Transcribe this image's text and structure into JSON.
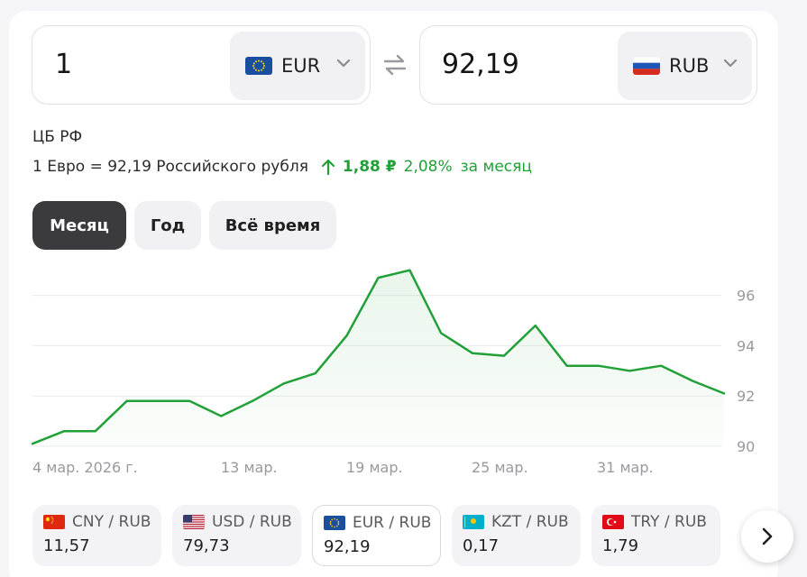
{
  "converter": {
    "from": {
      "amount": "1",
      "currency": "EUR",
      "flag_icon": "eu-flag-icon"
    },
    "to": {
      "amount": "92,19",
      "currency": "RUB",
      "flag_icon": "ru-flag-icon"
    },
    "swap_icon": "swap-icon"
  },
  "source": "ЦБ РФ",
  "rate": {
    "text": "1 Евро = 92,19 Российского рубля",
    "change_abs": "1,88 ₽",
    "change_pct": "2,08%",
    "period": "за месяц",
    "trend": "up",
    "accent_color": "#21a038"
  },
  "tabs": [
    {
      "label": "Месяц",
      "active": true
    },
    {
      "label": "Год",
      "active": false
    },
    {
      "label": "Всё время",
      "active": false
    }
  ],
  "chart_data": {
    "type": "area",
    "x_labels": [
      "4 мар. 2026 г.",
      "13 мар.",
      "19 мар.",
      "25 мар.",
      "31 мар."
    ],
    "y_ticks": [
      90,
      92,
      94,
      96
    ],
    "ylim": [
      90,
      97
    ],
    "values": [
      90.1,
      90.6,
      90.6,
      91.8,
      91.8,
      91.8,
      91.2,
      91.8,
      92.5,
      92.9,
      94.4,
      96.7,
      97.0,
      94.5,
      93.7,
      93.6,
      94.8,
      93.2,
      93.2,
      93.0,
      93.2,
      92.6,
      92.1
    ],
    "line_color": "#21a038",
    "grid": true
  },
  "pairs": [
    {
      "label": "CNY / RUB",
      "value": "11,57",
      "flag_icon": "cn-flag-icon",
      "active": false
    },
    {
      "label": "USD / RUB",
      "value": "79,73",
      "flag_icon": "us-flag-icon",
      "active": false
    },
    {
      "label": "EUR / RUB",
      "value": "92,19",
      "flag_icon": "eu-flag-icon",
      "active": true
    },
    {
      "label": "KZT / RUB",
      "value": "0,17",
      "flag_icon": "kz-flag-icon",
      "active": false
    },
    {
      "label": "TRY / RUB",
      "value": "1,79",
      "flag_icon": "tr-flag-icon",
      "active": false
    }
  ],
  "next_icon": "chevron-right-icon"
}
